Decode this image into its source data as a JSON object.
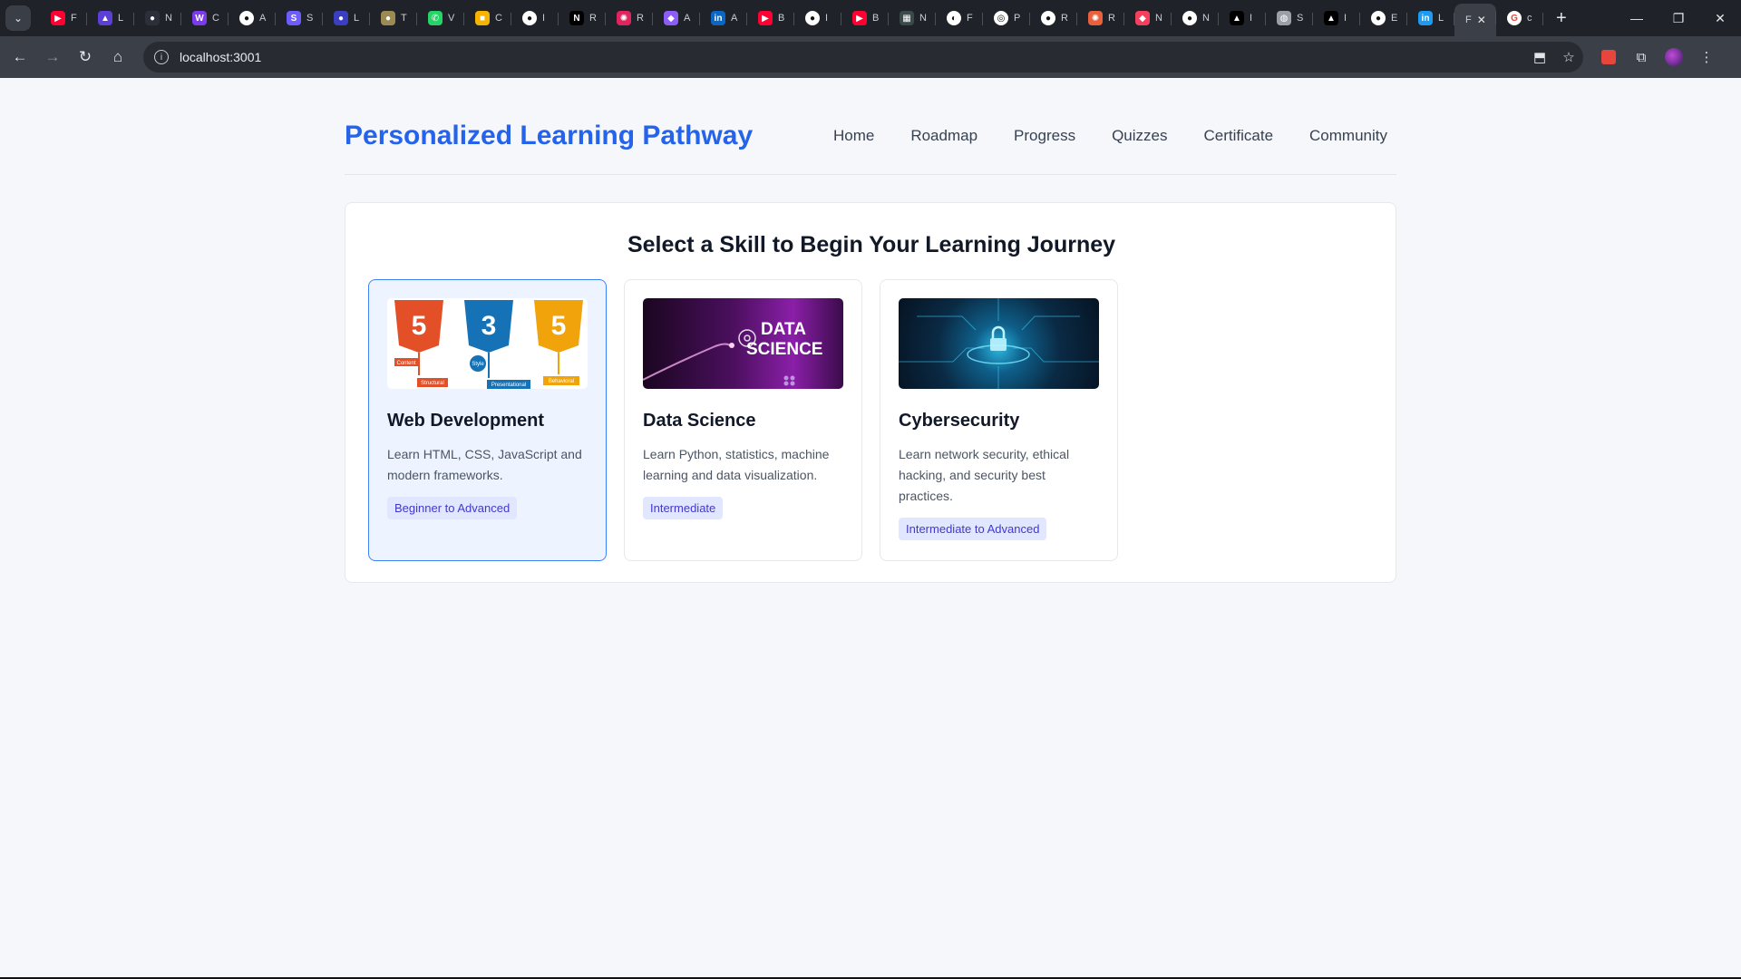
{
  "browser": {
    "tabs": [
      {
        "initial": "F",
        "color": "#ff0033",
        "glyph": "▶"
      },
      {
        "initial": "L",
        "color": "#5b3fd6",
        "glyph": "▲"
      },
      {
        "initial": "N",
        "color": "#2a2f3a",
        "glyph": "●"
      },
      {
        "initial": "C",
        "color": "#7c3aed",
        "glyph": "W"
      },
      {
        "initial": "A",
        "color": "#ffffff",
        "glyph": "●"
      },
      {
        "initial": "S",
        "color": "#6d5dfc",
        "glyph": "S"
      },
      {
        "initial": "L",
        "color": "#3b3fbf",
        "glyph": "●"
      },
      {
        "initial": "T",
        "color": "#9c8a52",
        "glyph": "●"
      },
      {
        "initial": "V",
        "color": "#25d366",
        "glyph": "✆"
      },
      {
        "initial": "C",
        "color": "#f5b400",
        "glyph": "■"
      },
      {
        "initial": "I",
        "color": "#ffffff",
        "glyph": "●"
      },
      {
        "initial": "R",
        "color": "#000000",
        "glyph": "N"
      },
      {
        "initial": "R",
        "color": "#e0245e",
        "glyph": "✺"
      },
      {
        "initial": "A",
        "color": "#8b5cf6",
        "glyph": "◆"
      },
      {
        "initial": "A",
        "color": "#0a66c2",
        "glyph": "in"
      },
      {
        "initial": "B",
        "color": "#ff0033",
        "glyph": "▶"
      },
      {
        "initial": "I",
        "color": "#ffffff",
        "glyph": "●"
      },
      {
        "initial": "B",
        "color": "#ff0033",
        "glyph": "▶"
      },
      {
        "initial": "N",
        "color": "#3a4a4a",
        "glyph": "▦"
      },
      {
        "initial": "F",
        "color": "#ffffff",
        "glyph": "◐"
      },
      {
        "initial": "P",
        "color": "#ffffff",
        "glyph": "◎"
      },
      {
        "initial": "R",
        "color": "#ffffff",
        "glyph": "●"
      },
      {
        "initial": "R",
        "color": "#e8603c",
        "glyph": "✺"
      },
      {
        "initial": "N",
        "color": "#f43f5e",
        "glyph": "◆"
      },
      {
        "initial": "N",
        "color": "#ffffff",
        "glyph": "●"
      },
      {
        "initial": "I",
        "color": "#000000",
        "glyph": "▲"
      },
      {
        "initial": "S",
        "color": "#9aa0a6",
        "glyph": "◍"
      },
      {
        "initial": "I",
        "color": "#000000",
        "glyph": "▲"
      },
      {
        "initial": "E",
        "color": "#ffffff",
        "glyph": "●"
      },
      {
        "initial": "L",
        "color": "#1d9bf0",
        "glyph": "in"
      }
    ],
    "active_tab": {
      "initial": "F",
      "close": "✕"
    },
    "last_tab": {
      "initial": "c",
      "color": "#ffffff",
      "glyph": "G"
    },
    "url": "localhost:3001"
  },
  "header": {
    "brand": "Personalized Learning Pathway",
    "nav": [
      "Home",
      "Roadmap",
      "Progress",
      "Quizzes",
      "Certificate",
      "Community"
    ]
  },
  "main": {
    "title": "Select a Skill to Begin Your Learning Journey",
    "skills": [
      {
        "title": "Web Development",
        "description": "Learn HTML, CSS, JavaScript and modern frameworks.",
        "level": "Beginner to Advanced",
        "selected": true,
        "image": "html-css-js-shields",
        "image_text": [
          "Content",
          "Structural",
          "Style",
          "Presentational",
          "Behavioral"
        ]
      },
      {
        "title": "Data Science",
        "description": "Learn Python, statistics, machine learning and data visualization.",
        "level": "Intermediate",
        "selected": false,
        "image": "data-science-banner",
        "image_text": [
          "DATA",
          "SCIENCE"
        ]
      },
      {
        "title": "Cybersecurity",
        "description": "Learn network security, ethical hacking, and security best practices.",
        "level": "Intermediate to Advanced",
        "selected": false,
        "image": "circuit-lock-banner",
        "image_text": []
      }
    ]
  }
}
